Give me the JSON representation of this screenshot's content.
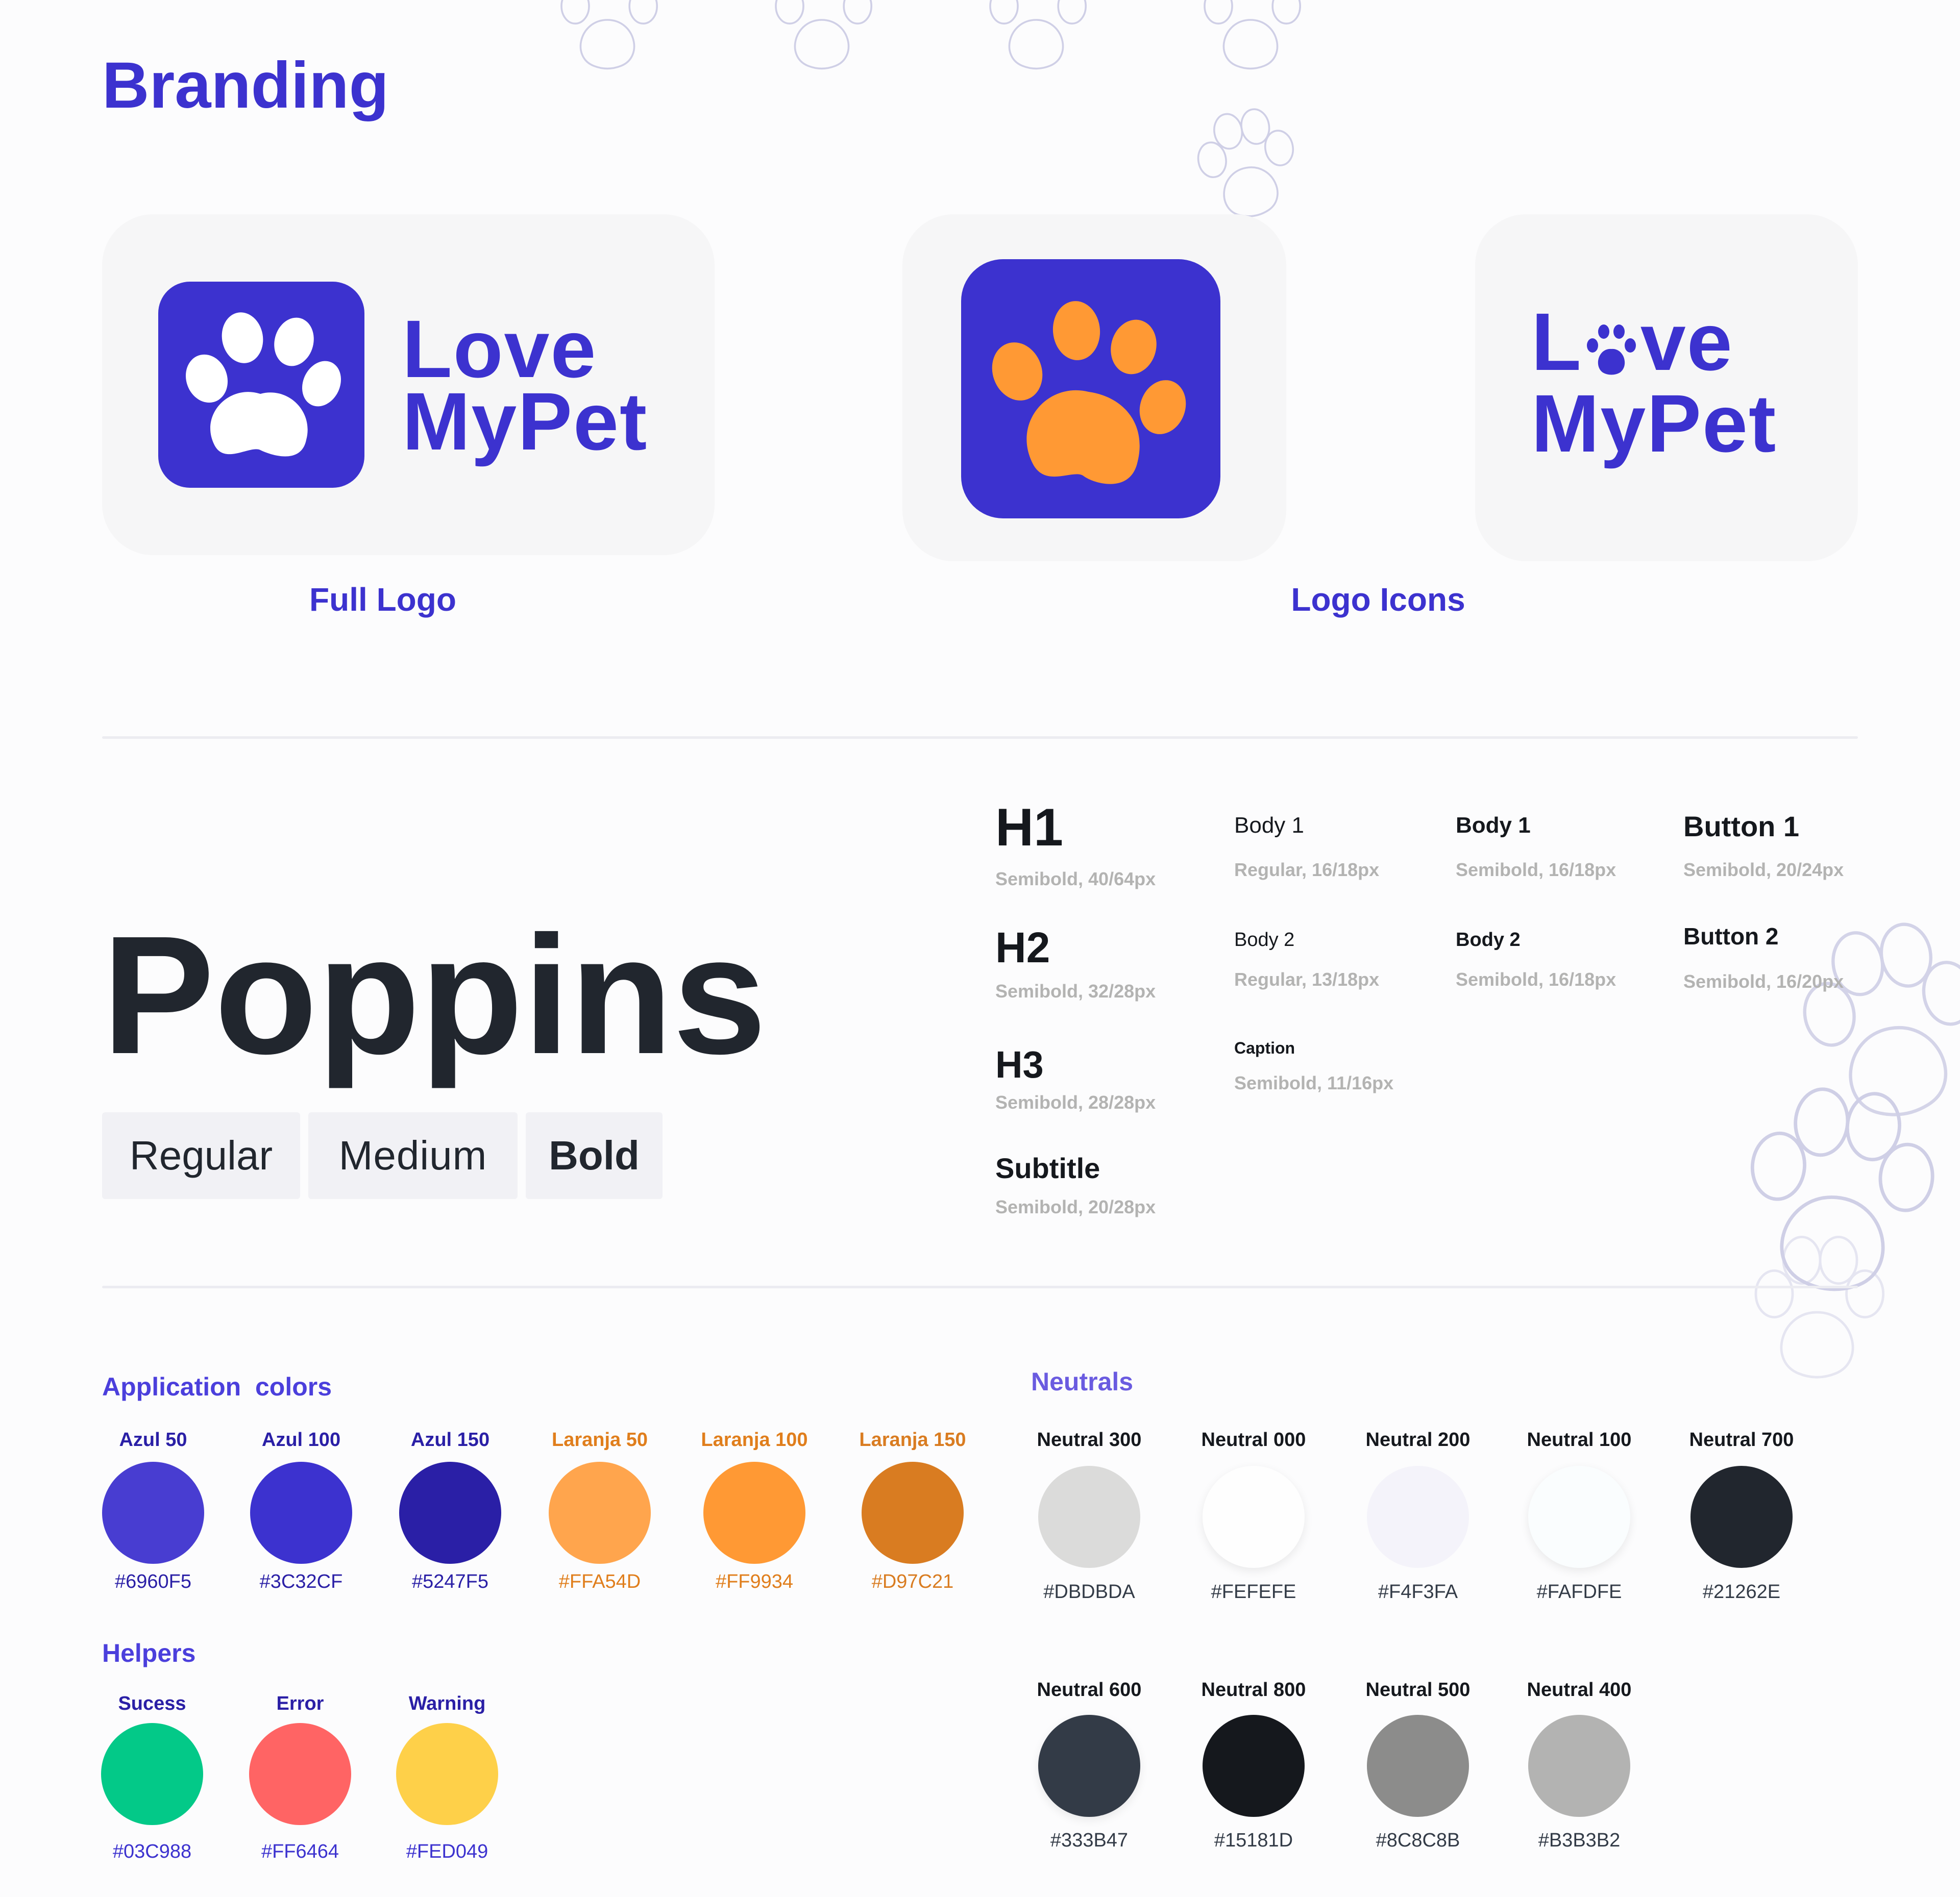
{
  "page": {
    "title": "Branding"
  },
  "logos": {
    "brand_line1": "Love",
    "brand_line2": "MyPet",
    "brand_line1_split_a": "L",
    "brand_line1_split_b": "ve",
    "full_logo_label": "Full Logo",
    "logo_icons_label": "Logo Icons",
    "colors": {
      "primary": "#3C32CF",
      "accent": "#FF9934",
      "card": "#F6F6F7"
    }
  },
  "typography": {
    "font_name": "Poppins",
    "weights": [
      "Regular",
      "Medium",
      "Bold"
    ],
    "styles": [
      {
        "name": "H1",
        "spec": "Semibold, 40/64px"
      },
      {
        "name": "H2",
        "spec": "Semibold, 32/28px"
      },
      {
        "name": "H3",
        "spec": "Semibold, 28/28px"
      },
      {
        "name": "Subtitle",
        "spec": "Semibold, 20/28px"
      },
      {
        "name": "Body 1",
        "spec": "Regular, 16/18px"
      },
      {
        "name": "Body 2",
        "spec": "Regular, 13/18px"
      },
      {
        "name": "Caption",
        "spec": "Semibold, 11/16px"
      },
      {
        "name": "Body 1",
        "spec": "Semibold, 16/18px"
      },
      {
        "name": "Body 2",
        "spec": "Semibold, 16/18px"
      },
      {
        "name": "Button 1",
        "spec": "Semibold, 20/24px"
      },
      {
        "name": "Button 2",
        "spec": "Semibold, 16/20px"
      }
    ]
  },
  "colors": {
    "application_title": "Application  colors",
    "application": [
      {
        "name": "Azul 50",
        "hex": "#6960F5",
        "fill": "#483DD1",
        "tone": "#2A1FA6"
      },
      {
        "name": "Azul 100",
        "hex": "#3C32CF",
        "fill": "#3C32CF",
        "tone": "#2A1FA6"
      },
      {
        "name": "Azul 150",
        "hex": "#5247F5",
        "fill": "#2A1FA6",
        "tone": "#2A1FA6"
      },
      {
        "name": "Laranja 50",
        "hex": "#FFA54D",
        "fill": "#FFA54D",
        "tone": "#E07E1C"
      },
      {
        "name": "Laranja 100",
        "hex": "#FF9934",
        "fill": "#FF9934",
        "tone": "#E07E1C"
      },
      {
        "name": "Laranja 150",
        "hex": "#D97C21",
        "fill": "#D97C21",
        "tone": "#D97C21"
      }
    ],
    "helpers_title": "Helpers",
    "helpers": [
      {
        "name": "Sucess",
        "hex": "#03C988",
        "fill": "#03C988",
        "tone": "#2A1FA6"
      },
      {
        "name": "Error",
        "hex": "#FF6464",
        "fill": "#FF6464",
        "tone": "#2A1FA6"
      },
      {
        "name": "Warning",
        "hex": "#FED049",
        "fill": "#FED049",
        "tone": "#2A1FA6"
      }
    ],
    "neutrals_title": "Neutrals",
    "neutrals_row1": [
      {
        "name": "Neutral 300",
        "hex": "#DBDBDA",
        "fill": "#DBDBDA"
      },
      {
        "name": "Neutral 000",
        "hex": "#FEFEFE",
        "fill": "#FEFEFE"
      },
      {
        "name": "Neutral 200",
        "hex": "#F4F3FA",
        "fill": "#F4F3FA"
      },
      {
        "name": "Neutral 100",
        "hex": "#FAFDFE",
        "fill": "#FAFDFE"
      },
      {
        "name": "Neutral 700",
        "hex": "#21262E",
        "fill": "#21262E"
      }
    ],
    "neutrals_row2": [
      {
        "name": "Neutral 600",
        "hex": "#333B47",
        "fill": "#333B47"
      },
      {
        "name": "Neutral 800",
        "hex": "#15181D",
        "fill": "#15181D"
      },
      {
        "name": "Neutral 500",
        "hex": "#8C8C8B",
        "fill": "#8C8C8B"
      },
      {
        "name": "Neutral 400",
        "hex": "#B3B3B2",
        "fill": "#B3B3B2"
      }
    ]
  }
}
